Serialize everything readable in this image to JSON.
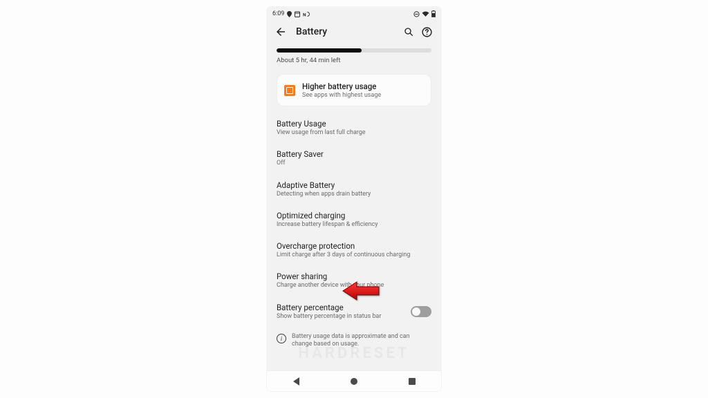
{
  "status": {
    "time": "6:09",
    "left_icons": [
      "location-icon",
      "calendar-icon",
      "nfc-icon"
    ],
    "right_icons": [
      "dnd-icon",
      "wifi-icon",
      "battery-icon"
    ]
  },
  "appbar": {
    "title": "Battery"
  },
  "battery": {
    "progress_percent": 55,
    "remaining_text": "About 5 hr, 44 min left"
  },
  "card": {
    "title": "Higher battery usage",
    "subtitle": "See apps with highest usage"
  },
  "items": [
    {
      "title": "Battery Usage",
      "subtitle": "View usage from last full charge"
    },
    {
      "title": "Battery Saver",
      "subtitle": "Off"
    },
    {
      "title": "Adaptive Battery",
      "subtitle": "Detecting when apps drain battery"
    },
    {
      "title": "Optimized charging",
      "subtitle": "Increase battery lifespan & efficiency"
    },
    {
      "title": "Overcharge protection",
      "subtitle": "Limit charge after 3 days of continuous charging"
    },
    {
      "title": "Power sharing",
      "subtitle": "Charge another device with your phone"
    },
    {
      "title": "Battery percentage",
      "subtitle": "Show battery percentage in status bar"
    }
  ],
  "info_text": "Battery usage data is approximate and can change based on usage.",
  "watermark": "HARDRESET"
}
